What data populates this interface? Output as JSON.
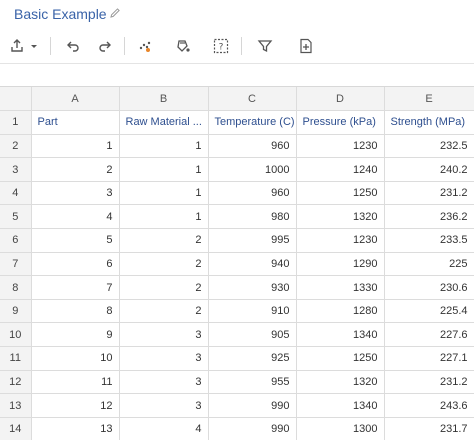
{
  "app": {
    "title": "Basic Example"
  },
  "toolbar": {
    "icons": [
      "upload-icon",
      "chevron-down-icon",
      "undo-icon",
      "redo-icon",
      "scatter-icon",
      "fill-icon",
      "help-box-icon",
      "filter-icon",
      "add-file-icon"
    ]
  },
  "grid": {
    "column_letters": [
      "A",
      "B",
      "C",
      "D",
      "E"
    ],
    "header_row_number": "1",
    "headers": [
      "Part",
      "Raw Material ...",
      "Temperature (C)",
      "Pressure (kPa)",
      "Strength (MPa)"
    ],
    "rows": [
      {
        "n": "2",
        "cells": [
          "1",
          "1",
          "960",
          "1230",
          "232.5"
        ]
      },
      {
        "n": "3",
        "cells": [
          "2",
          "1",
          "1000",
          "1240",
          "240.2"
        ]
      },
      {
        "n": "4",
        "cells": [
          "3",
          "1",
          "960",
          "1250",
          "231.2"
        ]
      },
      {
        "n": "5",
        "cells": [
          "4",
          "1",
          "980",
          "1320",
          "236.2"
        ]
      },
      {
        "n": "6",
        "cells": [
          "5",
          "2",
          "995",
          "1230",
          "233.5"
        ]
      },
      {
        "n": "7",
        "cells": [
          "6",
          "2",
          "940",
          "1290",
          "225"
        ]
      },
      {
        "n": "8",
        "cells": [
          "7",
          "2",
          "930",
          "1330",
          "230.6"
        ]
      },
      {
        "n": "9",
        "cells": [
          "8",
          "2",
          "910",
          "1280",
          "225.4"
        ]
      },
      {
        "n": "10",
        "cells": [
          "9",
          "3",
          "905",
          "1340",
          "227.6"
        ]
      },
      {
        "n": "11",
        "cells": [
          "10",
          "3",
          "925",
          "1250",
          "227.1"
        ]
      },
      {
        "n": "12",
        "cells": [
          "11",
          "3",
          "955",
          "1320",
          "231.2"
        ]
      },
      {
        "n": "13",
        "cells": [
          "12",
          "3",
          "990",
          "1340",
          "243.6"
        ]
      },
      {
        "n": "14",
        "cells": [
          "13",
          "4",
          "990",
          "1300",
          "231.7"
        ]
      }
    ]
  },
  "colors": {
    "title": "#3a63a8",
    "header_text": "#2e4f8f",
    "accent_orange": "#e8862a"
  }
}
